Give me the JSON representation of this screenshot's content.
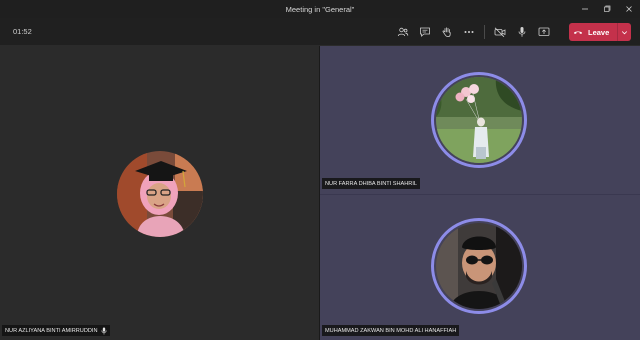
{
  "window": {
    "title": "Meeting in \"General\"",
    "controls": [
      "minimize-icon",
      "maximize-icon",
      "close-icon"
    ]
  },
  "toolbar": {
    "timer": "01:52",
    "leave_label": "Leave",
    "icons": [
      "participants-icon",
      "chat-icon",
      "raise-hand-icon",
      "more-icon",
      "camera-icon",
      "microphone-icon",
      "share-screen-icon"
    ],
    "leave_color": "#c4314b"
  },
  "participants": [
    {
      "name": "NUR AZLIYANA BINTI AMIRRUDDIN",
      "muted_icon": "mic-icon"
    },
    {
      "name": "NUR FARRA DHIBA BINTI SHAHRIL"
    },
    {
      "name": "MUHAMMAD ZAKWAN BIN MOHD ALI HANAFFIAH"
    }
  ],
  "colors": {
    "left_stage": "#2b2b2b",
    "right_stage": "#44425a",
    "speaking_ring": "#8d8ce8"
  }
}
